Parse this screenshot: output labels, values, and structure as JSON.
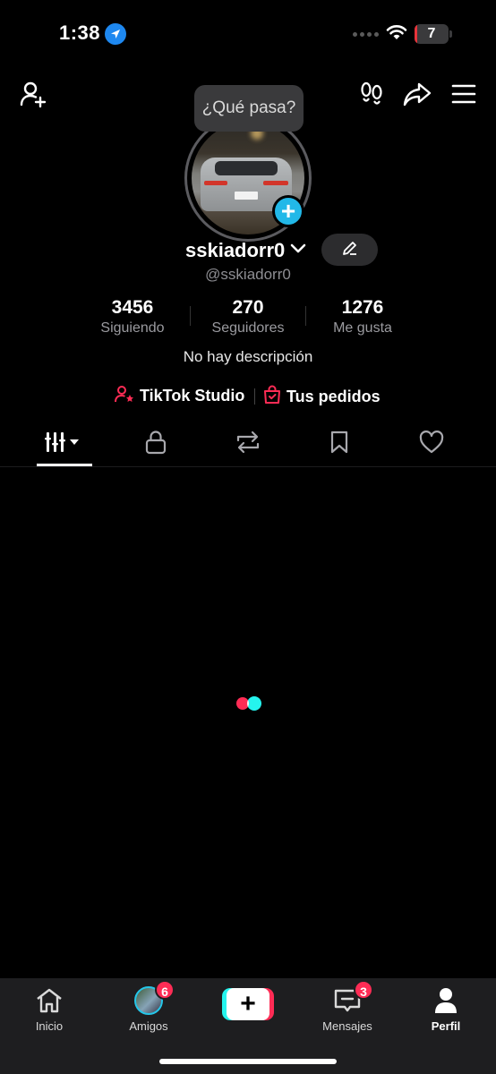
{
  "status_bar": {
    "time": "1:38",
    "battery_level": "7",
    "battery_fraction": 0.07,
    "battery_color": "#e7333a"
  },
  "top_nav": {
    "icons": [
      "add-friend-icon",
      "footprint-icon",
      "share-icon",
      "menu-icon"
    ]
  },
  "tooltip": {
    "text": "¿Qué pasa?"
  },
  "profile": {
    "username": "sskiadorr0",
    "handle": "@sskiadorr0",
    "bio": "No hay descripción",
    "avatar_add_symbol": "+"
  },
  "stats": [
    {
      "value": "3456",
      "label": "Siguiendo"
    },
    {
      "value": "270",
      "label": "Seguidores"
    },
    {
      "value": "1276",
      "label": "Me gusta"
    }
  ],
  "links": {
    "studio": "TikTok Studio",
    "orders": "Tus pedidos",
    "accent_color": "#fe2c55"
  },
  "tabs": [
    "videos-grid-icon",
    "lock-icon",
    "repost-icon",
    "bookmark-icon",
    "heart-icon"
  ],
  "bottom_nav": {
    "items": [
      {
        "label": "Inicio",
        "icon": "home-icon"
      },
      {
        "label": "Amigos",
        "icon": "friends-avatar",
        "badge": "6"
      },
      {
        "label": "",
        "icon": "create-plus-icon"
      },
      {
        "label": "Mensajes",
        "icon": "inbox-icon",
        "badge": "3"
      },
      {
        "label": "Perfil",
        "icon": "profile-icon"
      }
    ],
    "create_symbol": "+"
  },
  "colors": {
    "background": "#000000",
    "accent_red": "#fe2c55",
    "accent_cyan": "#25f4ee",
    "avatar_add": "#22b8e8"
  }
}
